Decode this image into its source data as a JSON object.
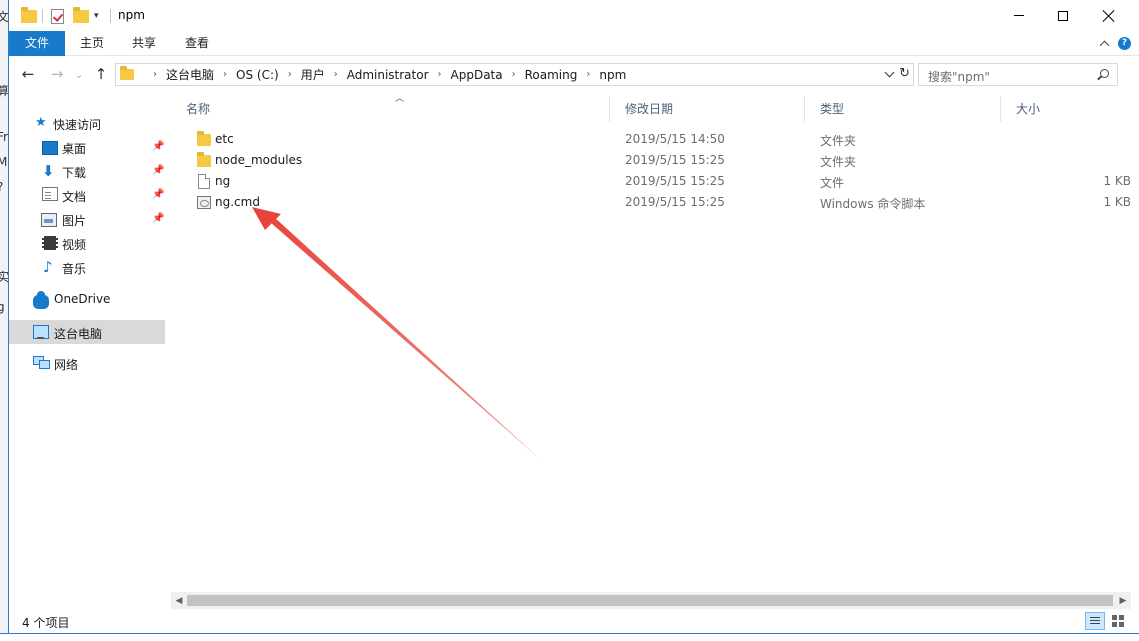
{
  "titlebar": {
    "title": "npm",
    "quick_access_dropdown": "▾"
  },
  "ribbon": {
    "tabs": [
      {
        "label": "文件"
      },
      {
        "label": "主页"
      },
      {
        "label": "共享"
      },
      {
        "label": "查看"
      }
    ],
    "accent_color": "#1979ca"
  },
  "address": {
    "breadcrumbs": [
      "这台电脑",
      "OS (C:)",
      "用户",
      "Administrator",
      "AppData",
      "Roaming",
      "npm"
    ],
    "search_placeholder": "搜索\"npm\""
  },
  "nav": {
    "items": [
      {
        "label": "快速访问",
        "icon": "star-icon"
      },
      {
        "label": "桌面",
        "icon": "desktop-icon",
        "pinned": true
      },
      {
        "label": "下载",
        "icon": "download-icon",
        "pinned": true
      },
      {
        "label": "文档",
        "icon": "document-icon",
        "pinned": true
      },
      {
        "label": "图片",
        "icon": "pictures-icon",
        "pinned": true
      },
      {
        "label": "视频",
        "icon": "video-icon"
      },
      {
        "label": "音乐",
        "icon": "music-icon"
      },
      {
        "label": "OneDrive",
        "icon": "onedrive-icon"
      },
      {
        "label": "这台电脑",
        "icon": "this-pc-icon",
        "selected": true
      },
      {
        "label": "网络",
        "icon": "network-icon"
      }
    ]
  },
  "columns": {
    "name": "名称",
    "date": "修改日期",
    "type": "类型",
    "size": "大小"
  },
  "files": [
    {
      "name": "etc",
      "date": "2019/5/15 14:50",
      "type": "文件夹",
      "size": "",
      "icon": "folder-icon"
    },
    {
      "name": "node_modules",
      "date": "2019/5/15 15:25",
      "type": "文件夹",
      "size": "",
      "icon": "folder-icon"
    },
    {
      "name": "ng",
      "date": "2019/5/15 15:25",
      "type": "文件",
      "size": "1 KB",
      "icon": "file-icon"
    },
    {
      "name": "ng.cmd",
      "date": "2019/5/15 15:25",
      "type": "Windows 命令脚本",
      "size": "1 KB",
      "icon": "cmd-script-icon"
    }
  ],
  "status": {
    "item_count": "4 个项目"
  },
  "annotation": {
    "arrow_color": "#e8433b",
    "points_to": "ng.cmd"
  }
}
